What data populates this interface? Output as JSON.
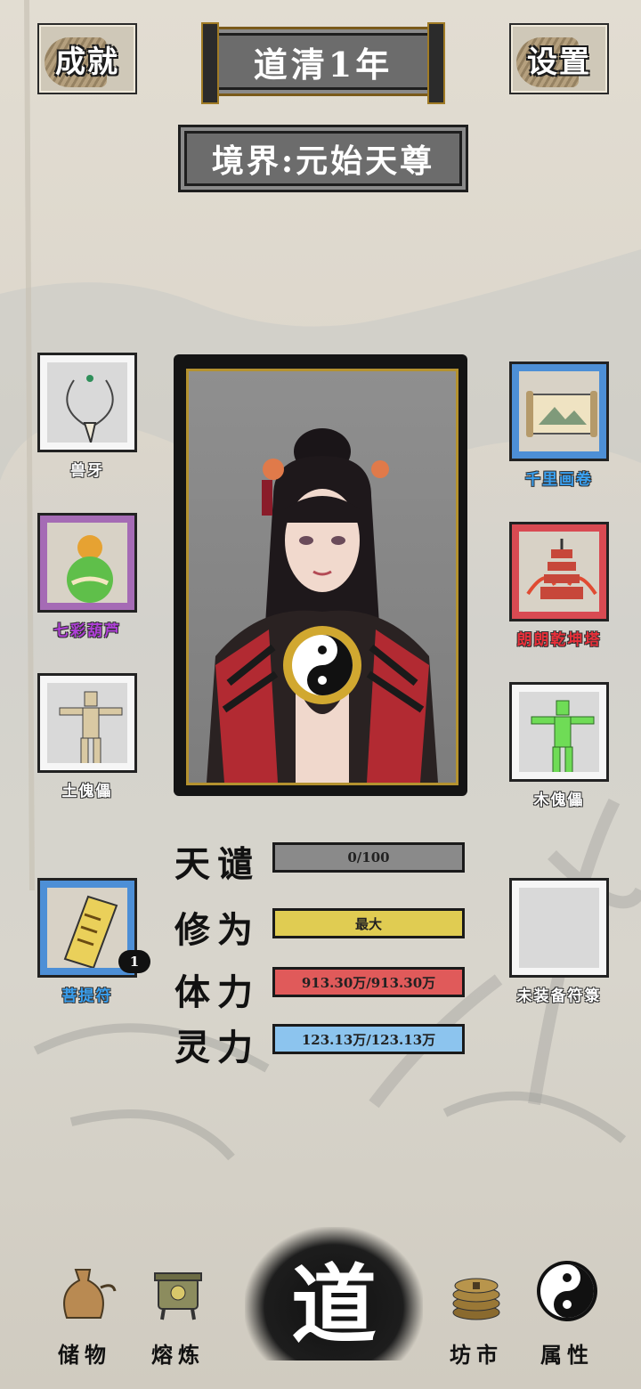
{
  "header": {
    "achievements_label": "成就",
    "settings_label": "设置",
    "year": "道清1年",
    "realm": "境界:元始天尊"
  },
  "left_slots": [
    {
      "name": "兽牙",
      "color": "#ffffff"
    },
    {
      "name": "七彩葫芦",
      "color": "#b040d8"
    },
    {
      "name": "土傀儡",
      "color": "#ffffff"
    },
    {
      "name": "菩提符",
      "color": "#3aa0f0",
      "count": "1"
    }
  ],
  "right_slots": [
    {
      "name": "千里画卷",
      "color": "#3aa0f0"
    },
    {
      "name": "朗朗乾坤塔",
      "color": "#e8303a"
    },
    {
      "name": "木傀儡",
      "color": "#ffffff"
    },
    {
      "name": "未装备符箓",
      "color": "#ffffff"
    }
  ],
  "stats": [
    {
      "label": "天谴",
      "value": "0/100",
      "fill_fraction": 0.0,
      "color": "#8a8a8a"
    },
    {
      "label": "修为",
      "value": "最大",
      "fill_fraction": 1.0,
      "color": "#e0cc52"
    },
    {
      "label": "体力",
      "value": "913.30万/913.30万",
      "fill_fraction": 1.0,
      "color": "#e05a5a"
    },
    {
      "label": "灵力",
      "value": "123.13万/123.13万",
      "fill_fraction": 1.0,
      "color": "#8cc4ee"
    }
  ],
  "nav": {
    "storage": "储物",
    "smelt": "熔炼",
    "dao": "道",
    "market": "坊市",
    "attributes": "属性"
  }
}
